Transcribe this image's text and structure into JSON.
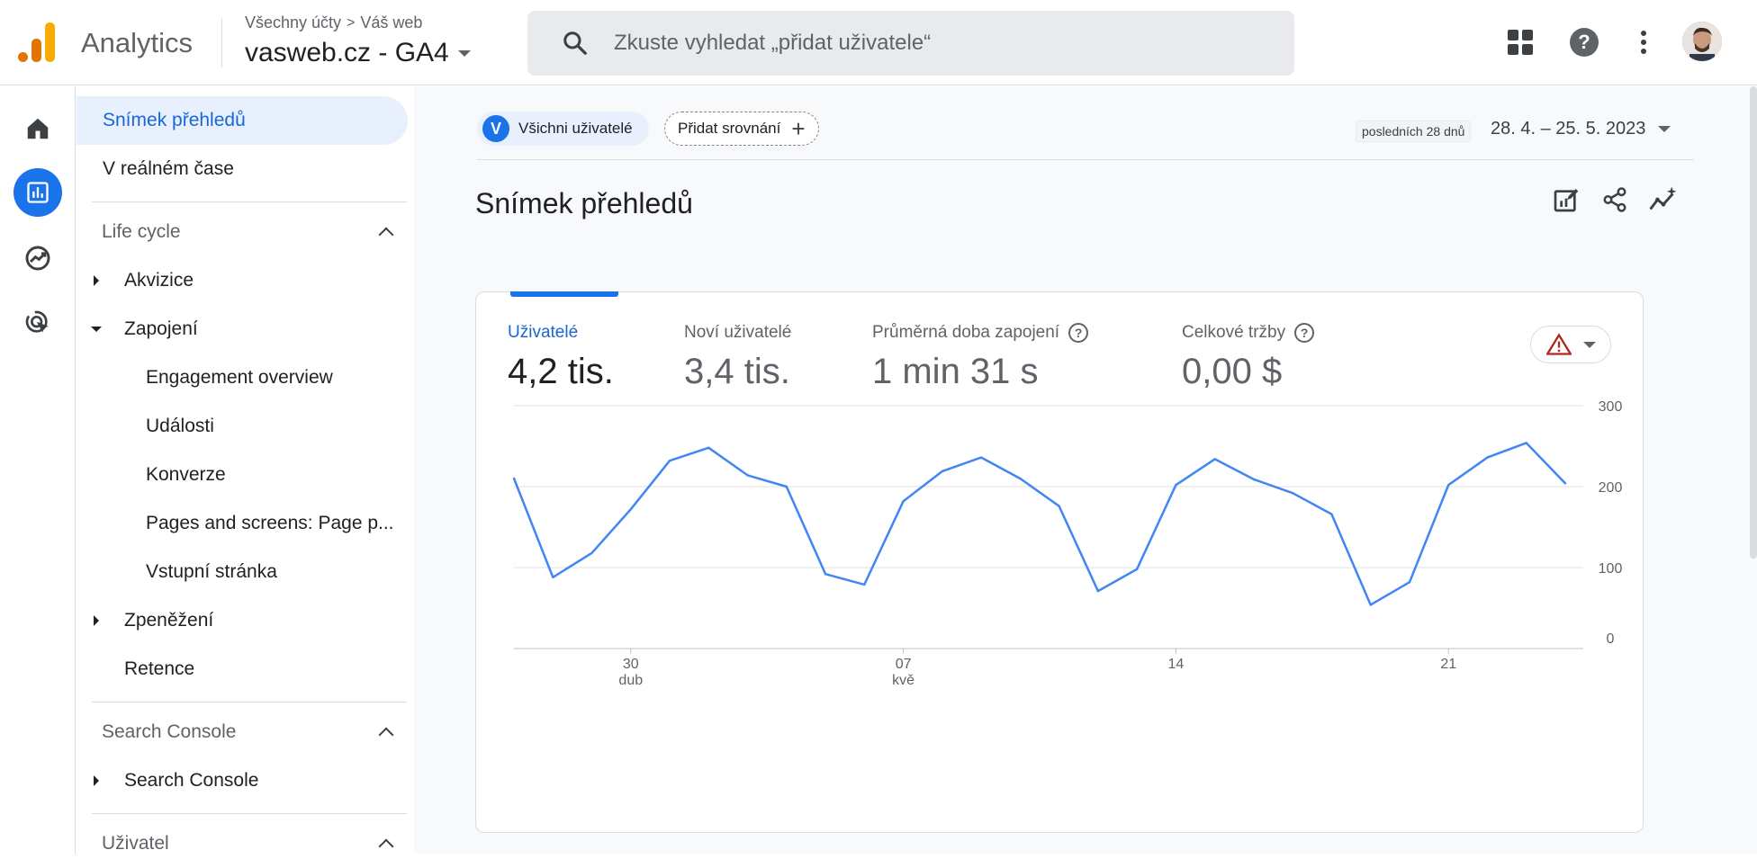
{
  "header": {
    "app_title": "Analytics",
    "breadcrumb": {
      "account": "Všechny účty",
      "separator": ">",
      "property": "Váš web"
    },
    "property_name": "vasweb.cz - GA4",
    "search_placeholder": "Zkuste vyhledat „přidat uživatele“",
    "icons": [
      "apps-grid-icon",
      "help-icon",
      "more-vert-icon",
      "avatar"
    ]
  },
  "rail": {
    "items": [
      {
        "name": "home-icon",
        "active": false
      },
      {
        "name": "reports-icon",
        "active": true
      },
      {
        "name": "explore-icon",
        "active": false
      },
      {
        "name": "advertising-icon",
        "active": false
      }
    ]
  },
  "nav": {
    "top_items": [
      {
        "label": "Snímek přehledů",
        "selected": true
      },
      {
        "label": "V reálném čase",
        "selected": false
      }
    ],
    "sections": [
      {
        "title": "Life cycle",
        "items": [
          {
            "label": "Akvizice",
            "expanded": false
          },
          {
            "label": "Zapojení",
            "expanded": true,
            "children": [
              "Engagement overview",
              "Události",
              "Konverze",
              "Pages and screens: Page p...",
              "Vstupní stránka"
            ]
          },
          {
            "label": "Zpeněžení",
            "expanded": false
          },
          {
            "label": "Retence"
          }
        ]
      },
      {
        "title": "Search Console",
        "items": [
          {
            "label": "Search Console",
            "expanded": false
          }
        ]
      },
      {
        "title": "Uživatel",
        "items": []
      }
    ]
  },
  "toolbar": {
    "segment_initial": "V",
    "segment_label": "Všichni uživatelé",
    "add_comparison_label": "Přidat srovnání",
    "date_badge": "posledních 28 dnů",
    "date_range": "28. 4. – 25. 5. 2023"
  },
  "page": {
    "title": "Snímek přehledů",
    "tools": [
      "customize-report-icon",
      "share-icon",
      "insights-icon"
    ]
  },
  "metrics": [
    {
      "label": "Uživatelé",
      "value": "4,2 tis.",
      "active": true,
      "help": false
    },
    {
      "label": "Noví uživatelé",
      "value": "3,4 tis.",
      "active": false,
      "help": false
    },
    {
      "label": "Průměrná doba zapojení",
      "value": "1 min 31 s",
      "active": false,
      "help": true
    },
    {
      "label": "Celkové tržby",
      "value": "0,00 $",
      "active": false,
      "help": true
    }
  ],
  "colors": {
    "accent": "#1a73e8",
    "line": "#4285f4",
    "warning": "#b3261e"
  },
  "chart_data": {
    "type": "line",
    "series": [
      {
        "values": [
          210,
          88,
          118,
          172,
          232,
          248,
          214,
          200,
          92,
          79,
          182,
          219,
          236,
          210,
          176,
          71,
          98,
          202,
          234,
          209,
          192,
          166,
          54,
          82,
          202,
          236,
          254,
          204
        ]
      }
    ],
    "x_tick_labels": [
      {
        "index": 3,
        "day": "30",
        "month": "dub"
      },
      {
        "index": 10,
        "day": "07",
        "month": "kvě"
      },
      {
        "index": 17,
        "day": "14",
        "month": ""
      },
      {
        "index": 24,
        "day": "21",
        "month": ""
      }
    ],
    "y_ticks": [
      "0",
      "100",
      "200",
      "300"
    ],
    "ylim": [
      0,
      300
    ],
    "grid": true
  }
}
